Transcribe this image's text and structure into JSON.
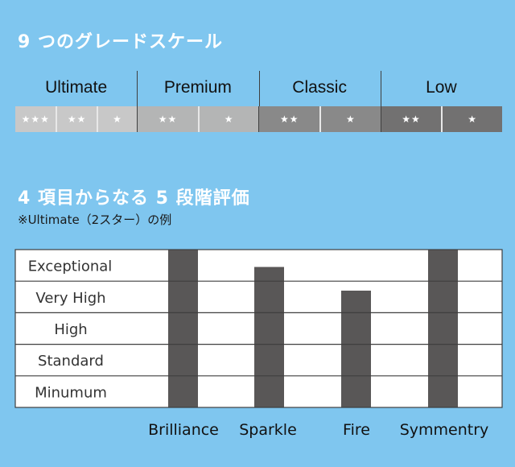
{
  "section1": {
    "title": "9 つのグレードスケール",
    "grades": [
      {
        "name": "Ultimate",
        "sublevels": [
          "★★★",
          "★★",
          "★"
        ],
        "color": "#c8c8c8"
      },
      {
        "name": "Premium",
        "sublevels": [
          "★★",
          "★"
        ],
        "color": "#b4b5b5"
      },
      {
        "name": "Classic",
        "sublevels": [
          "★★",
          "★"
        ],
        "color": "#898989"
      },
      {
        "name": "Low",
        "sublevels": [
          "★★",
          "★"
        ],
        "color": "#727171"
      }
    ]
  },
  "section2": {
    "title": "4 項目からなる 5 段階評価",
    "note": "※Ultimate（2スター）の例"
  },
  "colors": {
    "background": "#7fc6ef",
    "bar": "#595757",
    "plot_bg": "#ffffff",
    "grid": "#3f3f3f"
  },
  "chart_data": {
    "type": "bar",
    "title": "4 項目からなる 5 段階評価",
    "subtitle": "※Ultimate（2スター）の例",
    "categories": [
      "Brilliance",
      "Sparkle",
      "Fire",
      "Symmentry"
    ],
    "levels": [
      "Minumum",
      "Standard",
      "High",
      "Very High",
      "Exceptional"
    ],
    "values": [
      5,
      4.45,
      3.7,
      5
    ],
    "ylim": [
      0,
      5
    ],
    "xlabel": "",
    "ylabel": "",
    "grid": true,
    "legend": "none"
  }
}
